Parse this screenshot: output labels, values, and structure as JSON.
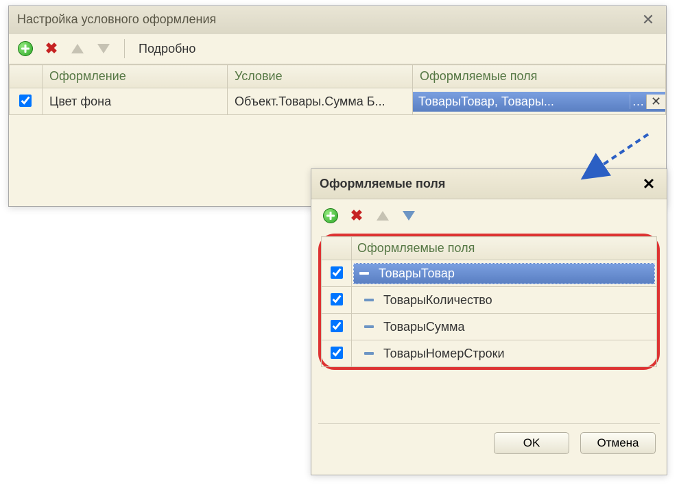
{
  "main": {
    "title": "Настройка условного оформления",
    "toolbar": {
      "detail": "Подробно"
    },
    "headers": {
      "c1": "Оформление",
      "c2": "Условие",
      "c3": "Оформляемые поля"
    },
    "row": {
      "c1": "Цвет фона",
      "c2": "Объект.Товары.Сумма Б...",
      "c3": "ТоварыТовар, Товары..."
    }
  },
  "sub": {
    "title": "Оформляемые поля",
    "header": "Оформляемые поля",
    "fields": {
      "f0": "ТоварыТовар",
      "f1": "ТоварыКоличество",
      "f2": "ТоварыСумма",
      "f3": "ТоварыНомерСтроки"
    },
    "ok": "OK",
    "cancel": "Отмена"
  }
}
